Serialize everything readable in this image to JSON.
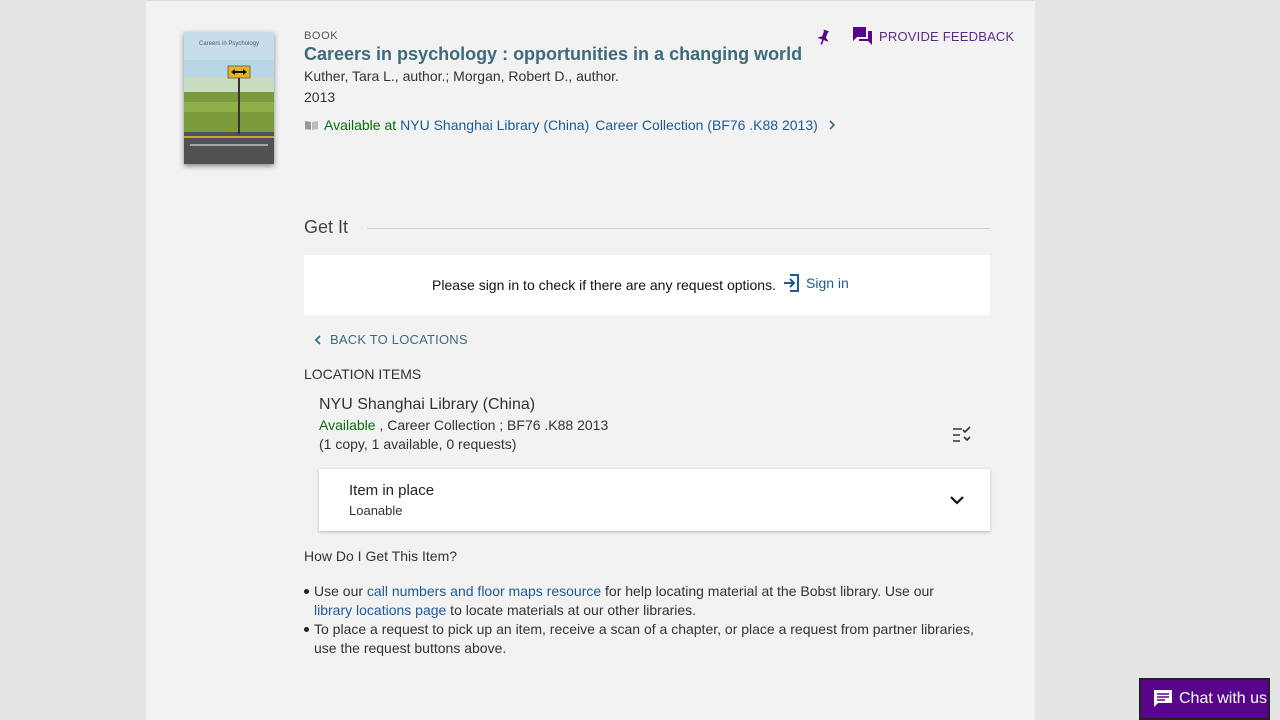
{
  "record": {
    "type_label": "BOOK",
    "title": "Careers in psychology : opportunities in a changing world",
    "authors": "Kuther, Tara L., author.; Morgan, Robert D., author.",
    "year": "2013",
    "availability": {
      "status": "Available at",
      "library": "NYU Shanghai Library (China)",
      "location": "Career Collection (BF76 .K88 2013)"
    },
    "cover": {
      "text": "Careers in Psychology"
    }
  },
  "actions": {
    "pin_icon": "pin-icon",
    "feedback_label": "PROVIDE FEEDBACK"
  },
  "get_it": {
    "heading": "Get It",
    "sign_in_prompt": "Please sign in to check if there are any request options.",
    "sign_in_label": "Sign in"
  },
  "locations": {
    "back_label": "BACK TO LOCATIONS",
    "items_heading": "LOCATION ITEMS",
    "library_name": "NYU Shanghai Library (China)",
    "status": "Available",
    "collection": " , Career Collection ; BF76 .K88 2013",
    "copies": "(1 copy, 1 available, 0 requests)",
    "item": {
      "name": "Item in place",
      "policy": "Loanable"
    }
  },
  "help": {
    "heading": "How Do I Get This Item?",
    "b1_pre": "Use our ",
    "b1_link1": "call numbers and floor maps resource",
    "b1_mid": " for help locating material at the Bobst library. Use our ",
    "b1_link2": "library locations page",
    "b1_post": " to locate materials at our other libraries.",
    "b2": "To place a request to pick up an item, receive a scan of a chapter, or place a request from partner libraries, use the request buttons above."
  },
  "chat": {
    "label": "Chat with us"
  },
  "colors": {
    "accent_purple": "#57068c",
    "available_green": "#0b6a0b",
    "link_blue": "#1d5a96",
    "title_teal": "#3d6b7e"
  }
}
